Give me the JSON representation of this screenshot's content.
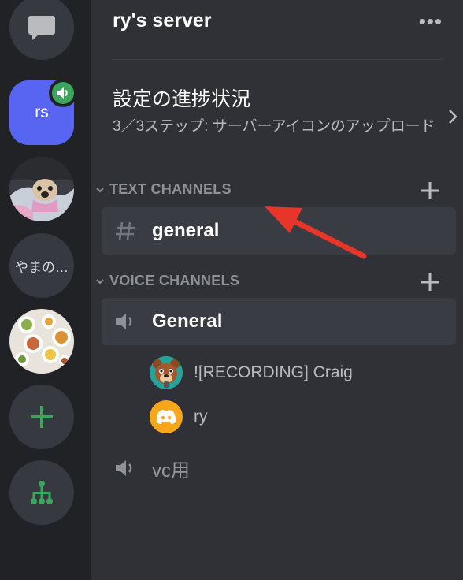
{
  "rail": {
    "servers": [
      {
        "kind": "dm-icon"
      },
      {
        "label": "rs",
        "active": true
      },
      {
        "kind": "dog-photo"
      },
      {
        "label": "やまの…"
      },
      {
        "kind": "food-photo"
      },
      {
        "kind": "add-server"
      },
      {
        "kind": "explore"
      }
    ]
  },
  "header": {
    "server_name": "ry's server",
    "more_label": "•••"
  },
  "progress": {
    "title": "設定の進捗状況",
    "subtitle": "3／3ステップ: サーバーアイコンのアップロード"
  },
  "categories": [
    {
      "label": "TEXT CHANNELS",
      "channels": [
        {
          "name": "general",
          "selected": true
        }
      ]
    },
    {
      "label": "VOICE CHANNELS",
      "channels": [
        {
          "name": "General",
          "selected": true,
          "users": [
            {
              "name": "![RECORDING] Craig"
            },
            {
              "name": "ry"
            }
          ]
        },
        {
          "name": "vc用",
          "selected": false
        }
      ]
    }
  ],
  "colors": {
    "accent": "#5865f2",
    "green": "#3ba55d",
    "arrow": "#e8352a"
  }
}
